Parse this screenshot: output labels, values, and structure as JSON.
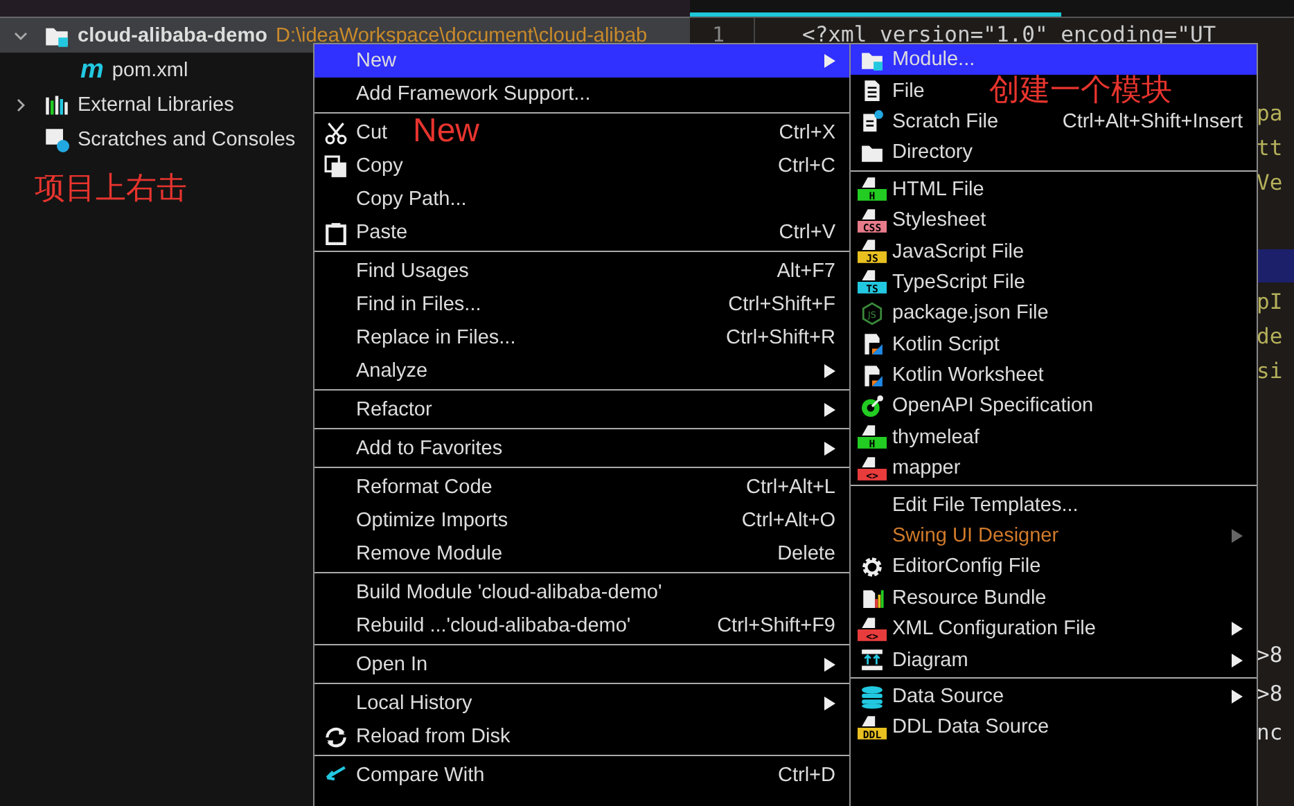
{
  "project_tree": {
    "items": [
      {
        "label": "cloud-alibaba-demo",
        "path": "D:\\ideaWorkspace\\document\\cloud-alibab",
        "kind": "module",
        "selected": true,
        "expanded": true,
        "children": [
          {
            "label": "pom.xml",
            "kind": "maven",
            "icon_letter": "m",
            "selected": false
          }
        ]
      },
      {
        "label": "External Libraries",
        "kind": "libraries",
        "selected": false,
        "expanded": false
      },
      {
        "label": "Scratches and Consoles",
        "kind": "scratches",
        "selected": false
      }
    ]
  },
  "editor": {
    "line_number": "1",
    "first_line": "<?xml version=\"1.0\" encoding=\"UT",
    "fragments_top": [
      "pa",
      "tt",
      "Ve"
    ],
    "fragments_mid": [
      "pI",
      "de",
      "si"
    ],
    "fragments_bottom": [
      ">8",
      ">8",
      "nc"
    ]
  },
  "context_menu": {
    "groups": [
      [
        {
          "label": "New",
          "selected": true,
          "submenu": true
        },
        {
          "label": "Add Framework Support...",
          "selected": false
        }
      ],
      [
        {
          "label": "Cut",
          "shortcut": "Ctrl+X",
          "kind": "scissors",
          "annotation": "New",
          "selected": false
        },
        {
          "label": "Copy",
          "shortcut": "Ctrl+C",
          "kind": "copy",
          "selected": false
        },
        {
          "label": "Copy Path...",
          "selected": false
        },
        {
          "label": "Paste",
          "shortcut": "Ctrl+V",
          "kind": "paste",
          "selected": false
        }
      ],
      [
        {
          "label": "Find Usages",
          "shortcut": "Alt+F7",
          "selected": false
        },
        {
          "label": "Find in Files...",
          "shortcut": "Ctrl+Shift+F",
          "selected": false
        },
        {
          "label": "Replace in Files...",
          "shortcut": "Ctrl+Shift+R",
          "selected": false
        },
        {
          "label": "Analyze",
          "submenu": true,
          "selected": false
        }
      ],
      [
        {
          "label": "Refactor",
          "submenu": true,
          "selected": false
        }
      ],
      [
        {
          "label": "Add to Favorites",
          "submenu": true,
          "selected": false
        }
      ],
      [
        {
          "label": "Reformat Code",
          "shortcut": "Ctrl+Alt+L",
          "selected": false
        },
        {
          "label": "Optimize Imports",
          "shortcut": "Ctrl+Alt+O",
          "selected": false
        },
        {
          "label": "Remove Module",
          "shortcut": "Delete",
          "selected": false
        }
      ],
      [
        {
          "label": "Build Module 'cloud-alibaba-demo'",
          "selected": false
        },
        {
          "label": "Rebuild ...'cloud-alibaba-demo'",
          "shortcut": "Ctrl+Shift+F9",
          "selected": false
        }
      ],
      [
        {
          "label": "Open In",
          "submenu": true,
          "selected": false
        }
      ],
      [
        {
          "label": "Local History",
          "submenu": true,
          "selected": false
        },
        {
          "label": "Reload from Disk",
          "kind": "reload",
          "selected": false
        }
      ],
      [
        {
          "label": "Compare With",
          "shortcut": "Ctrl+D",
          "kind": "compare",
          "selected": false
        }
      ]
    ]
  },
  "new_submenu": {
    "groups": [
      [
        {
          "label": "Module...",
          "kind": "module",
          "selected": true
        },
        {
          "label": "File",
          "kind": "file",
          "annotation": "创建一个模块",
          "selected": false
        },
        {
          "label": "Scratch File",
          "kind": "scratch",
          "shortcut": "Ctrl+Alt+Shift+Insert",
          "selected": false
        },
        {
          "label": "Directory",
          "kind": "folder",
          "selected": false
        }
      ],
      [
        {
          "label": "HTML File",
          "kind": "badge",
          "badge": "H",
          "color": "#22cc22",
          "selected": false
        },
        {
          "label": "Stylesheet",
          "kind": "badge",
          "badge": "CSS",
          "color": "#e87b8a",
          "selected": false
        },
        {
          "label": "JavaScript File",
          "kind": "badge",
          "badge": "JS",
          "color": "#e8c020",
          "selected": false
        },
        {
          "label": "TypeScript File",
          "kind": "badge",
          "badge": "TS",
          "color": "#22c8e0",
          "selected": false
        },
        {
          "label": "package.json File",
          "kind": "nodejs",
          "badge": "JS",
          "selected": false
        },
        {
          "label": "Kotlin Script",
          "kind": "kotlin",
          "selected": false
        },
        {
          "label": "Kotlin Worksheet",
          "kind": "kotlin",
          "selected": false
        },
        {
          "label": "OpenAPI Specification",
          "kind": "openapi",
          "selected": false
        },
        {
          "label": "thymeleaf",
          "kind": "badge",
          "badge": "H",
          "color": "#22cc22",
          "selected": false
        },
        {
          "label": "mapper",
          "kind": "badge",
          "badge": "<>",
          "color": "#e83c3c",
          "selected": false
        }
      ],
      [
        {
          "label": "Edit File Templates...",
          "selected": false
        },
        {
          "label": "Swing UI Designer",
          "submenu": true,
          "disabled": true,
          "selected": false
        },
        {
          "label": "EditorConfig File",
          "kind": "gear",
          "selected": false
        },
        {
          "label": "Resource Bundle",
          "kind": "bundle",
          "selected": false
        },
        {
          "label": "XML Configuration File",
          "kind": "badge",
          "badge": "<>",
          "color": "#e83c3c",
          "submenu": true,
          "selected": false
        },
        {
          "label": "Diagram",
          "kind": "diagram",
          "submenu": true,
          "selected": false
        }
      ],
      [
        {
          "label": "Data Source",
          "kind": "database",
          "submenu": true,
          "selected": false
        },
        {
          "label": "DDL Data Source",
          "kind": "badge",
          "badge": "DDL",
          "color": "#e8c020",
          "selected": false
        }
      ]
    ]
  },
  "annotations": {
    "tree_note": "项目上右击"
  }
}
